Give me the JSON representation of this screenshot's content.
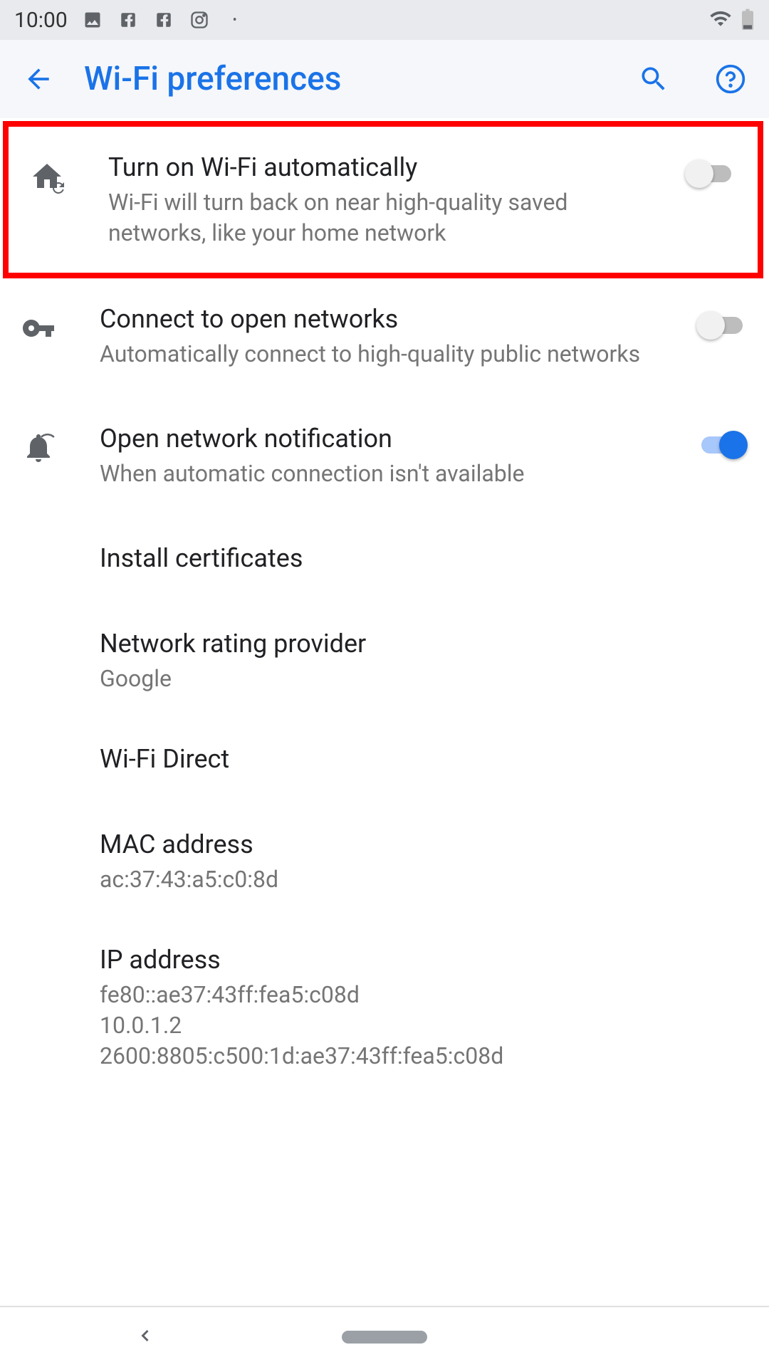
{
  "status_bar": {
    "time": "10:00"
  },
  "app_bar": {
    "title": "Wi-Fi preferences"
  },
  "settings": [
    {
      "title": "Turn on Wi-Fi automatically",
      "subtitle": "Wi-Fi will turn back on near high-quality saved networks, like your home network",
      "toggle": false,
      "highlighted": true
    },
    {
      "title": "Connect to open networks",
      "subtitle": "Automatically connect to high-quality public networks",
      "toggle": false
    },
    {
      "title": "Open network notification",
      "subtitle": "When automatic connection isn't available",
      "toggle": true
    },
    {
      "title": "Install certificates"
    },
    {
      "title": "Network rating provider",
      "subtitle": "Google"
    },
    {
      "title": "Wi-Fi Direct"
    },
    {
      "title": "MAC address",
      "subtitle": "ac:37:43:a5:c0:8d"
    },
    {
      "title": "IP address",
      "subtitle": "fe80::ae37:43ff:fea5:c08d\n10.0.1.2\n2600:8805:c500:1d:ae37:43ff:fea5:c08d"
    }
  ]
}
